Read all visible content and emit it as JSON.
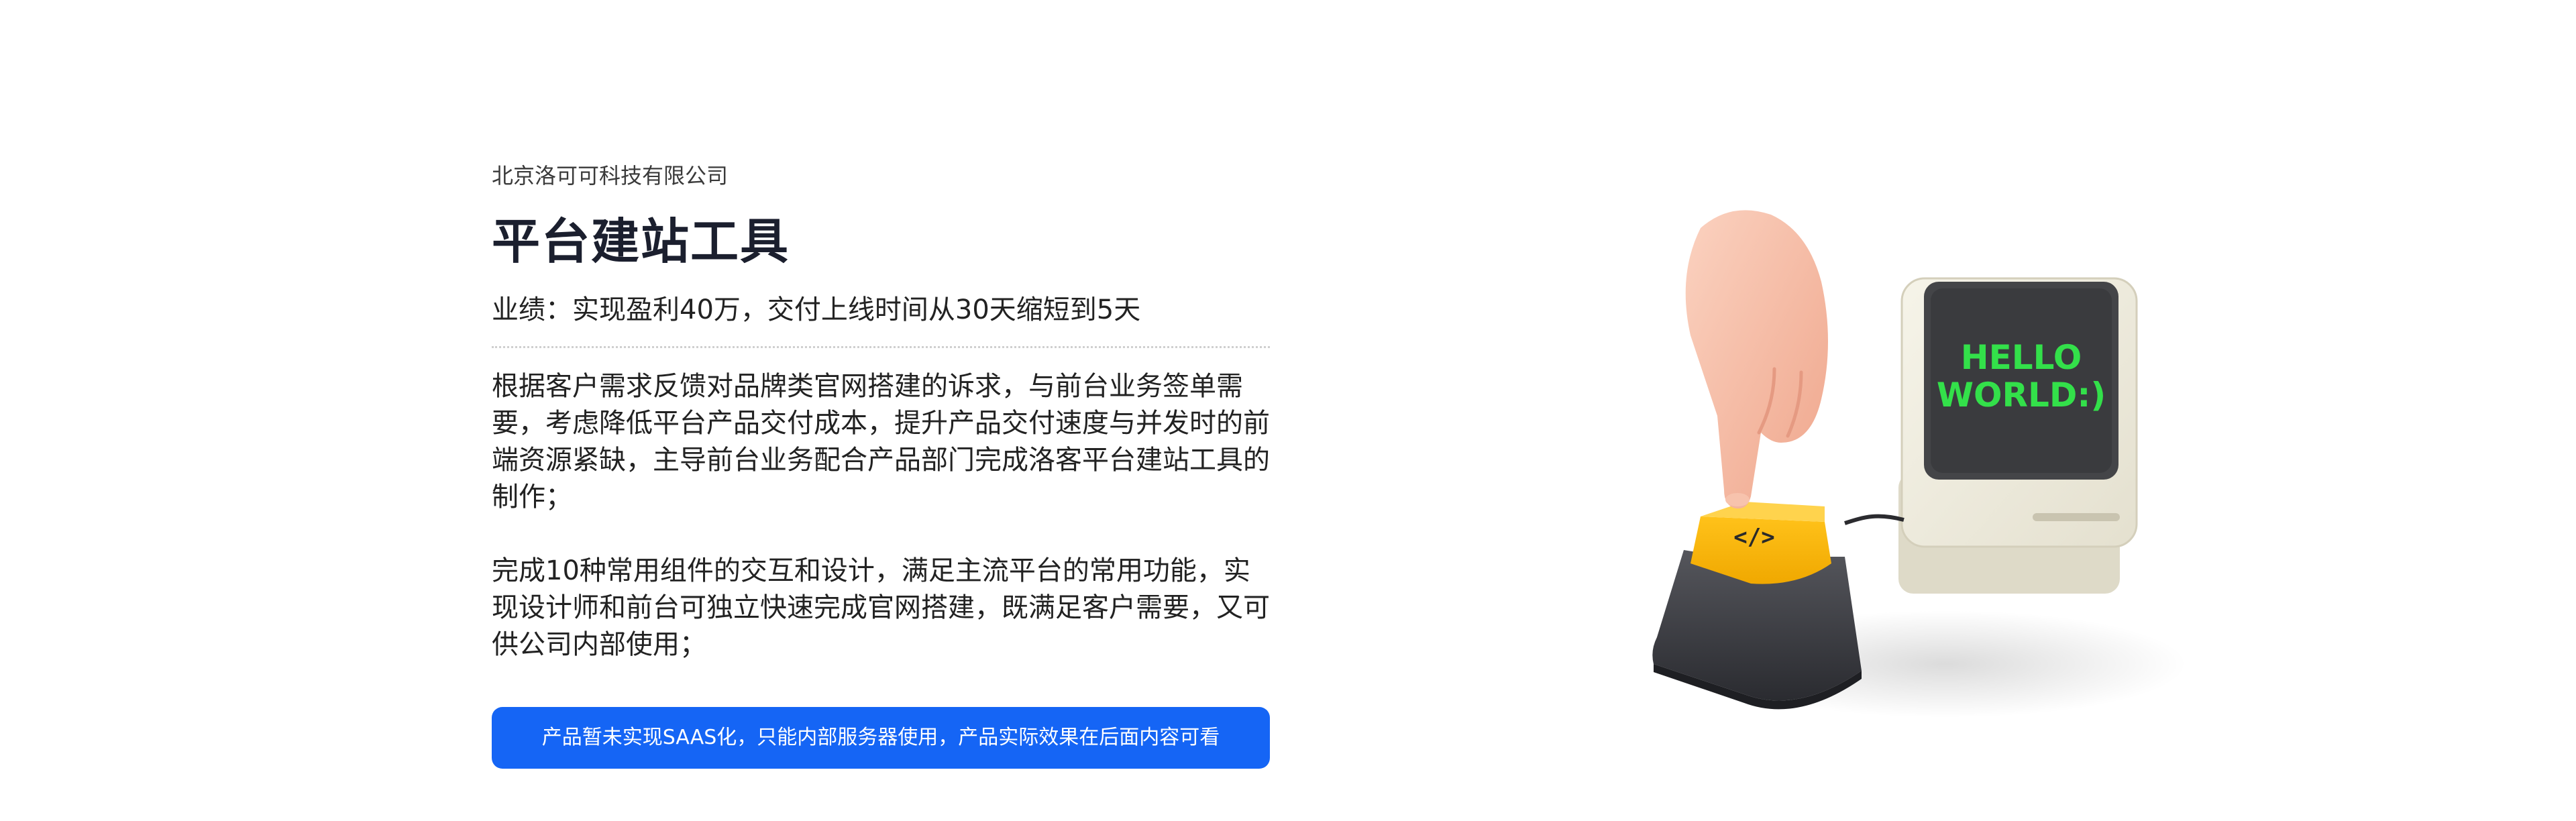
{
  "header": {
    "company": "北京洛可可科技有限公司",
    "title": "平台建站工具",
    "metric": "业绩：实现盈利40万，交付上线时间从30天缩短到5天"
  },
  "body": {
    "paragraph_1": "根据客户需求反馈对品牌类官网搭建的诉求，与前台业务签单需要，考虑降低平台产品交付成本，提升产品交付速度与并发时的前端资源紧缺，主导前台业务配合产品部门完成洛客平台建站工具的制作；",
    "paragraph_2": "完成10种常用组件的交互和设计，满足主流平台的常用功能，实现设计师和前台可独立快速完成官网搭建，既满足客户需要，又可供公司内部使用；"
  },
  "notice": {
    "text": "产品暂未实现SAAS化，只能内部服务器使用，产品实际效果在后面内容可看"
  },
  "illustration": {
    "screen_line_1": "HELLO",
    "screen_line_2": "WORLD:)",
    "key_symbol": "</>"
  },
  "colors": {
    "accent": "#1565f5",
    "screen_text": "#33e04a",
    "key_yellow": "#f7b500"
  }
}
